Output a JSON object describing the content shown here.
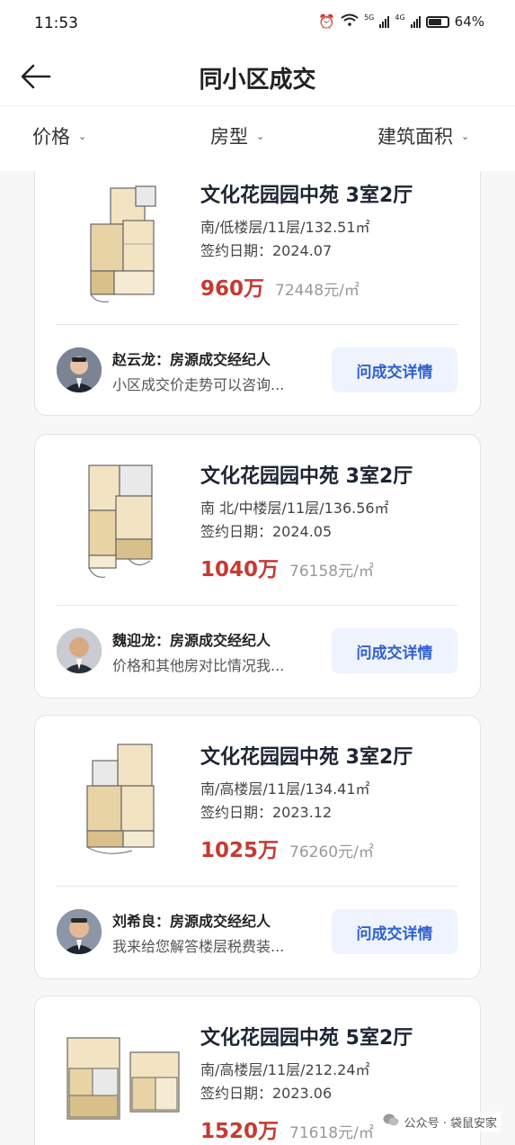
{
  "status_bar": {
    "time": "11:53",
    "network_1": "5G",
    "network_2": "4G",
    "battery": "64%"
  },
  "header": {
    "title": "同小区成交"
  },
  "filters": [
    {
      "label": "价格"
    },
    {
      "label": "房型"
    },
    {
      "label": "建筑面积"
    }
  ],
  "listings": [
    {
      "title": "文化花园园中苑 3室2厅",
      "meta": "南/低楼层/11层/132.51㎡",
      "date": "签约日期：2024.07",
      "price": "960万",
      "unit_price": "72448元/㎡",
      "agent_name": "赵云龙：房源成交经纪人",
      "agent_msg": "小区成交价走势可以咨询...",
      "button": "问成交详情"
    },
    {
      "title": "文化花园园中苑 3室2厅",
      "meta": "南 北/中楼层/11层/136.56㎡",
      "date": "签约日期：2024.05",
      "price": "1040万",
      "unit_price": "76158元/㎡",
      "agent_name": "魏迎龙：房源成交经纪人",
      "agent_msg": "价格和其他房对比情况我...",
      "button": "问成交详情"
    },
    {
      "title": "文化花园园中苑 3室2厅",
      "meta": "南/高楼层/11层/134.41㎡",
      "date": "签约日期：2023.12",
      "price": "1025万",
      "unit_price": "76260元/㎡",
      "agent_name": "刘希良：房源成交经纪人",
      "agent_msg": "我来给您解答楼层税费装...",
      "button": "问成交详情"
    },
    {
      "title": "文化花园园中苑 5室2厅",
      "meta": "南/高楼层/11层/212.24㎡",
      "date": "签约日期：2023.06",
      "price": "1520万",
      "unit_price": "71618元/㎡"
    }
  ],
  "watermark": "公众号 · 袋鼠安家",
  "colors": {
    "price": "#c63a32",
    "button_text": "#2f5fd0",
    "button_bg": "#eef3fd"
  }
}
